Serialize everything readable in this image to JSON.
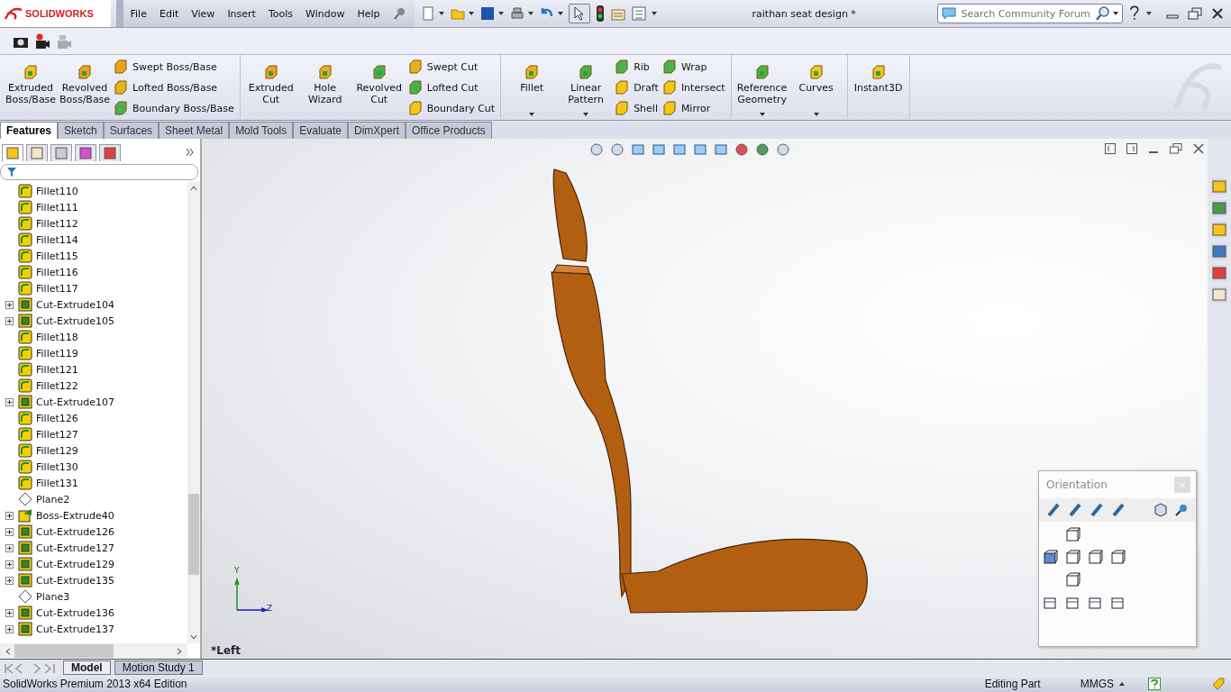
{
  "title_bar": {
    "brand": "SOLIDWORKS",
    "menu": [
      "File",
      "Edit",
      "View",
      "Insert",
      "Tools",
      "Window",
      "Help"
    ],
    "document_title": "raithan seat design *"
  },
  "search": {
    "placeholder": "Search Community Forum"
  },
  "ribbon": {
    "groups": [
      {
        "items": [
          {
            "kind": "large",
            "label": "Extruded Boss/Base",
            "dropdown": false
          },
          {
            "kind": "large",
            "label": "Revolved Boss/Base",
            "dropdown": false
          },
          {
            "kind": "stack",
            "labels": [
              "Swept Boss/Base",
              "Lofted Boss/Base",
              "Boundary Boss/Base"
            ]
          }
        ]
      },
      {
        "items": [
          {
            "kind": "large",
            "label": "Extruded Cut",
            "dropdown": false
          },
          {
            "kind": "large",
            "label": "Hole Wizard",
            "dropdown": false
          },
          {
            "kind": "large",
            "label": "Revolved Cut",
            "dropdown": false
          },
          {
            "kind": "stack",
            "labels": [
              "Swept Cut",
              "Lofted Cut",
              "Boundary Cut"
            ]
          }
        ]
      },
      {
        "items": [
          {
            "kind": "large",
            "label": "Fillet",
            "dropdown": true
          },
          {
            "kind": "large",
            "label": "Linear Pattern",
            "dropdown": true
          },
          {
            "kind": "stack",
            "labels": [
              "Rib",
              "Draft",
              "Shell"
            ]
          },
          {
            "kind": "stack",
            "labels": [
              "Wrap",
              "Intersect",
              "Mirror"
            ]
          }
        ]
      },
      {
        "items": [
          {
            "kind": "large",
            "label": "Reference Geometry",
            "dropdown": true
          },
          {
            "kind": "large",
            "label": "Curves",
            "dropdown": true
          }
        ]
      },
      {
        "items": [
          {
            "kind": "large",
            "label": "Instant3D",
            "dropdown": false
          }
        ]
      }
    ]
  },
  "tabs": [
    {
      "label": "Features",
      "selected": true
    },
    {
      "label": "Sketch",
      "selected": false
    },
    {
      "label": "Surfaces",
      "selected": false
    },
    {
      "label": "Sheet Metal",
      "selected": false
    },
    {
      "label": "Mold Tools",
      "selected": false
    },
    {
      "label": "Evaluate",
      "selected": false
    },
    {
      "label": "DimXpert",
      "selected": false
    },
    {
      "label": "Office Products",
      "selected": false
    }
  ],
  "panel_tabs": [
    {
      "selected": true
    },
    {
      "selected": false
    },
    {
      "selected": false
    },
    {
      "selected": false
    },
    {
      "selected": false
    }
  ],
  "tree": {
    "items": [
      {
        "label": "Fillet110",
        "kind": "fillet",
        "expandable": false
      },
      {
        "label": "Fillet111",
        "kind": "fillet",
        "expandable": false
      },
      {
        "label": "Fillet112",
        "kind": "fillet",
        "expandable": false
      },
      {
        "label": "Fillet114",
        "kind": "fillet",
        "expandable": false
      },
      {
        "label": "Fillet115",
        "kind": "fillet",
        "expandable": false
      },
      {
        "label": "Fillet116",
        "kind": "fillet",
        "expandable": false
      },
      {
        "label": "Fillet117",
        "kind": "fillet",
        "expandable": false
      },
      {
        "label": "Cut-Extrude104",
        "kind": "cut",
        "expandable": true
      },
      {
        "label": "Cut-Extrude105",
        "kind": "cut",
        "expandable": true
      },
      {
        "label": "Fillet118",
        "kind": "fillet",
        "expandable": false
      },
      {
        "label": "Fillet119",
        "kind": "fillet",
        "expandable": false
      },
      {
        "label": "Fillet121",
        "kind": "fillet",
        "expandable": false
      },
      {
        "label": "Fillet122",
        "kind": "fillet",
        "expandable": false
      },
      {
        "label": "Cut-Extrude107",
        "kind": "cut",
        "expandable": true
      },
      {
        "label": "Fillet126",
        "kind": "fillet",
        "expandable": false
      },
      {
        "label": "Fillet127",
        "kind": "fillet",
        "expandable": false
      },
      {
        "label": "Fillet129",
        "kind": "fillet",
        "expandable": false
      },
      {
        "label": "Fillet130",
        "kind": "fillet",
        "expandable": false
      },
      {
        "label": "Fillet131",
        "kind": "fillet",
        "expandable": false
      },
      {
        "label": "Plane2",
        "kind": "plane",
        "expandable": false
      },
      {
        "label": "Boss-Extrude40",
        "kind": "boss",
        "expandable": true
      },
      {
        "label": "Cut-Extrude126",
        "kind": "cut",
        "expandable": true
      },
      {
        "label": "Cut-Extrude127",
        "kind": "cut",
        "expandable": true
      },
      {
        "label": "Cut-Extrude129",
        "kind": "cut",
        "expandable": true
      },
      {
        "label": "Cut-Extrude135",
        "kind": "cut",
        "expandable": true
      },
      {
        "label": "Plane3",
        "kind": "plane",
        "expandable": false
      },
      {
        "label": "Cut-Extrude136",
        "kind": "cut",
        "expandable": true
      },
      {
        "label": "Cut-Extrude137",
        "kind": "cut",
        "expandable": true
      }
    ]
  },
  "viewport": {
    "view_name": "*Left",
    "axes": [
      "Y",
      "Z"
    ]
  },
  "orientation_panel": {
    "title": "Orientation"
  },
  "bottom_tabs": [
    {
      "label": "Model",
      "selected": true
    },
    {
      "label": "Motion Study 1",
      "selected": false
    }
  ],
  "status_bar": {
    "product": "SolidWorks Premium 2013 x64 Edition",
    "mode": "Editing Part",
    "units": "MMGS"
  }
}
